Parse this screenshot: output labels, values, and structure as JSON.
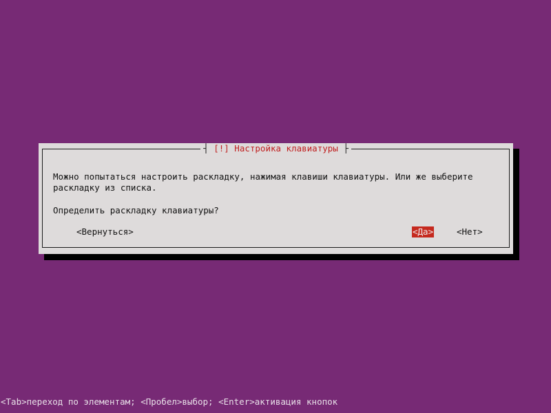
{
  "dialog": {
    "title_prefix": "[!]",
    "title": "Настройка клавиатуры",
    "message_line1": "Можно попытаться настроить раскладку, нажимая клавиши клавиатуры. Или же выберите",
    "message_line2": "раскладку из списка.",
    "question": "Определить раскладку клавиатуры?",
    "buttons": {
      "back": "<Вернуться>",
      "yes": "<Да>",
      "no": "<Нет>"
    }
  },
  "status_bar": {
    "hint": "<Tab>переход по элементам; <Пробел>выбор; <Enter>активация кнопок"
  },
  "colors": {
    "background": "#772a75",
    "dialog": "#dedbdb",
    "accent": "#c5291e"
  }
}
